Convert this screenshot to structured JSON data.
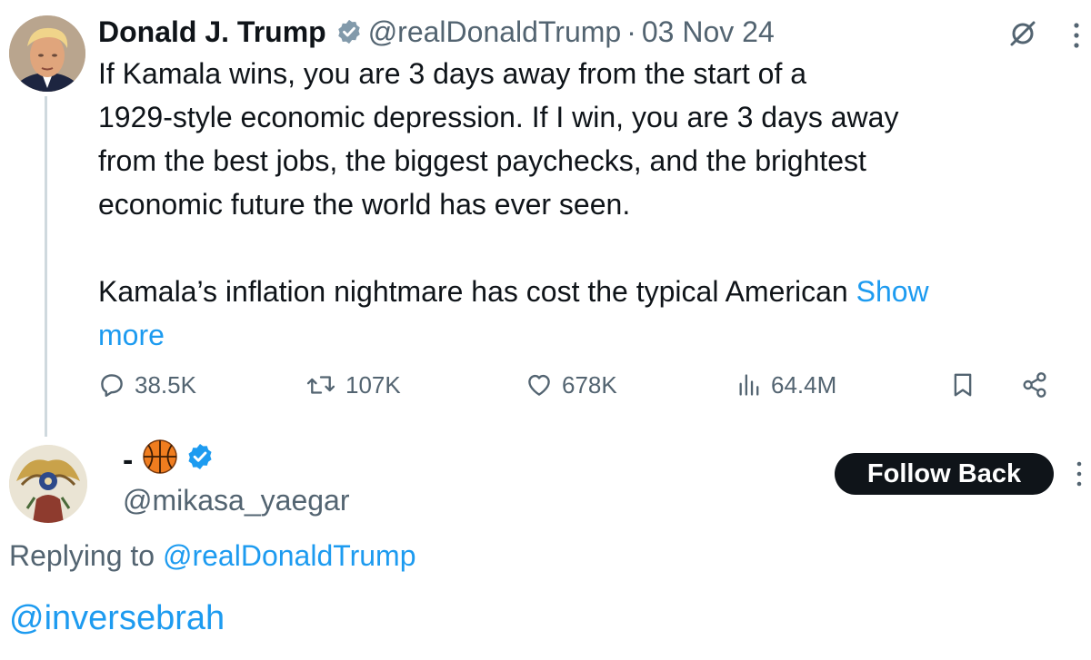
{
  "tweet": {
    "author_name": "Donald J. Trump",
    "author_handle": "@realDonaldTrump",
    "separator": "·",
    "date": "03 Nov 24",
    "text_lines": [
      "If Kamala wins, you are 3 days away from the start of a",
      "1929-style economic depression. If I win, you are 3 days away",
      "from the best jobs, the biggest paychecks, and the brightest",
      "economic future the world has ever seen."
    ],
    "text_second_paragraph": "Kamala’s inflation nightmare has cost the typical American ",
    "show_more_part1": "Show",
    "show_more_part2": "more",
    "stats": {
      "replies": "38.5K",
      "reposts": "107K",
      "likes": "678K",
      "views": "64.4M"
    },
    "badge_color": "#829aab",
    "icons": [
      "grok-icon",
      "more-icon",
      "reply-icon",
      "retweet-icon",
      "heart-icon",
      "views-icon",
      "bookmark-icon",
      "share-icon"
    ]
  },
  "reply": {
    "display_name": "-",
    "display_emoji": "🏀",
    "handle": "@mikasa_yaegar",
    "follow_button": "Follow Back",
    "replying_to_label": "Replying to",
    "replying_to_handle": "@realDonaldTrump",
    "body": "@inversebrah",
    "badge_color": "#1d9bf0"
  },
  "colors": {
    "accent": "#1d9bf0",
    "text_primary": "#0f1419",
    "text_secondary": "#536471",
    "thread_line": "#cfd9de",
    "button_bg": "#0f1419"
  }
}
